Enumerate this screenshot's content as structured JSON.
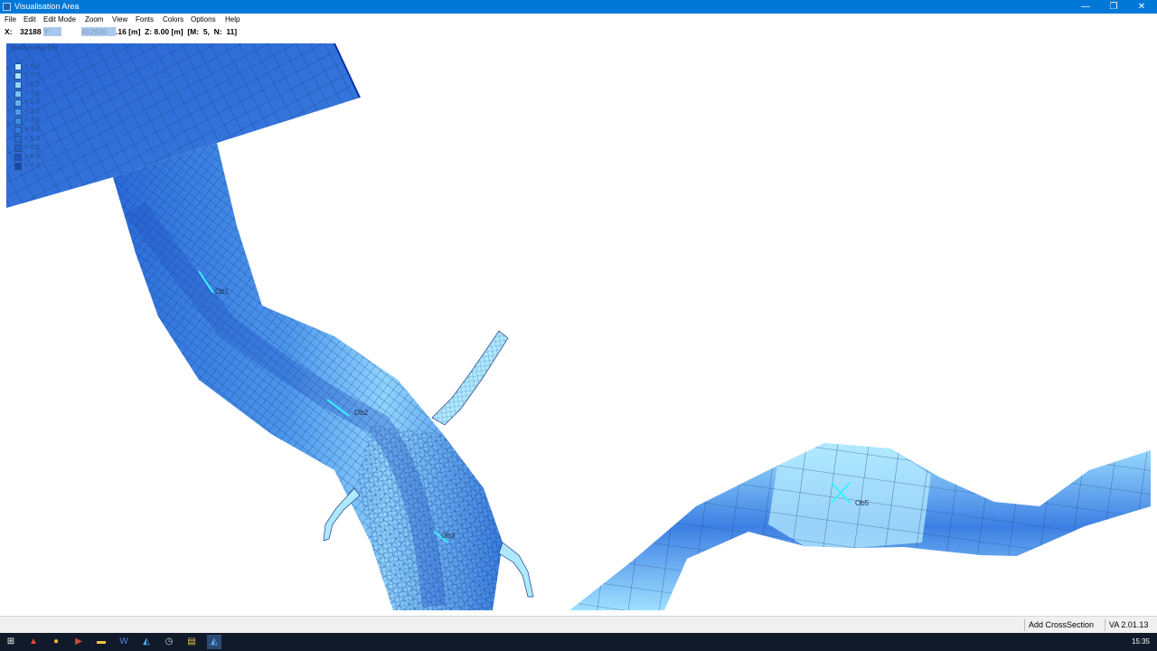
{
  "window": {
    "title": "Visualisation Area",
    "minimize": "—",
    "restore": "❐",
    "close": "✕"
  },
  "menu": [
    "File",
    "Edit",
    "Edit Mode",
    "Zoom",
    "View",
    "Fonts",
    "Colors",
    "Options",
    "Help"
  ],
  "coords": {
    "x_label": "X:",
    "x_value": "32188",
    "highlight_a": "Y:",
    "highlight_b": "402920",
    "rest": ".16 [m]  Z: 8.00 [m]  [M:  5,  N:  11]"
  },
  "legend": {
    "title": "Bathymetry [m]",
    "entries": [
      {
        "label": "< 0.2",
        "color": "#bff0ff"
      },
      {
        "label": "< 0.6",
        "color": "#a6e4ff"
      },
      {
        "label": "< 1.2",
        "color": "#8fd6ff"
      },
      {
        "label": "< 1.9",
        "color": "#79c6fb"
      },
      {
        "label": "< 2.5",
        "color": "#63b3f4"
      },
      {
        "label": "< 3.2",
        "color": "#50a0ee"
      },
      {
        "label": "< 3.9",
        "color": "#408de6"
      },
      {
        "label": "< 4.6",
        "color": "#347bdd"
      },
      {
        "label": "< 5.3",
        "color": "#2b6bd2"
      },
      {
        "label": "< 6.0",
        "color": "#245dc6"
      },
      {
        "label": "< 6.6",
        "color": "#1f51b9"
      },
      {
        "label": "< 7.3",
        "color": "#1a45a8"
      }
    ]
  },
  "observation_points": {
    "ob1": "Ob1",
    "ob2": "Ob2",
    "ob3": "Ob3",
    "ob5": "Ob5"
  },
  "status": {
    "add_cross_section": "Add CrossSection",
    "version": "VA 2.01.13"
  },
  "taskbar": {
    "clock": "15:35"
  },
  "colors": {
    "titlebar": "#0078d7",
    "deep_water": "#1a4fc4",
    "shallow_water": "#aee8ff"
  }
}
